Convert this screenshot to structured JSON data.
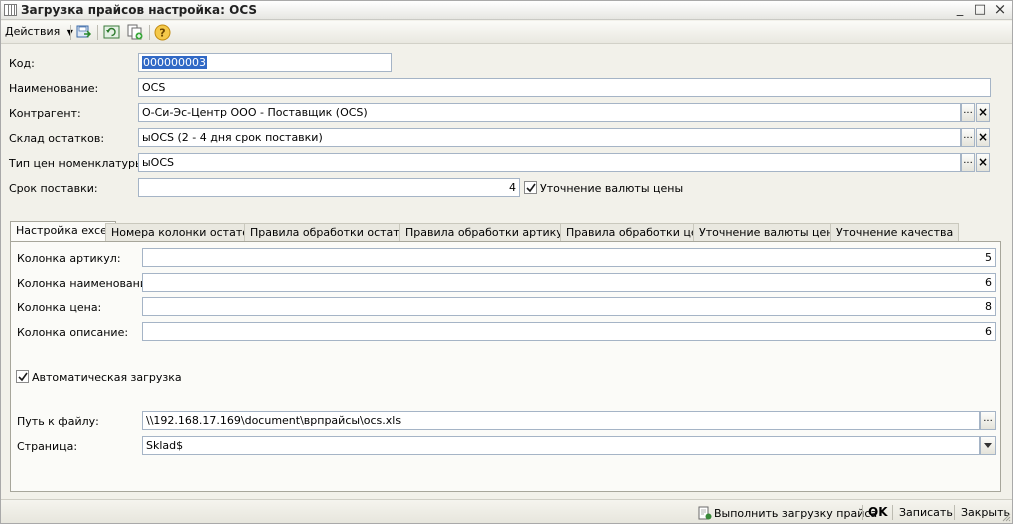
{
  "window": {
    "title": "Загрузка прайсов настройка: OCS",
    "controls": {
      "minimize": "_",
      "maximize": "□",
      "close": "×"
    }
  },
  "toolbar": {
    "actions_label": "Действия",
    "icons": [
      "save-and-close-icon",
      "refresh-icon",
      "copy-icon",
      "help-icon"
    ]
  },
  "form": {
    "code": {
      "label": "Код:",
      "value": "000000003"
    },
    "name": {
      "label": "Наименование:",
      "value": "OCS"
    },
    "counterparty": {
      "label": "Контрагент:",
      "value": "О-Си-Эс-Центр ООО - Поставщик (OCS)"
    },
    "warehouse": {
      "label": "Склад остатков:",
      "value": "ыOCS (2 - 4 дня срок поставки)"
    },
    "price_type": {
      "label": "Тип цен номенклатуры:",
      "value": "ыOCS"
    },
    "delivery_term": {
      "label": "Срок поставки:",
      "value": "4"
    },
    "currency_check": {
      "label": "Уточнение валюты цены",
      "checked": true
    },
    "select_button": "...",
    "clear_button": "×"
  },
  "tabs": [
    {
      "label": "Настройка excel",
      "active": true
    },
    {
      "label": "Номера колонки остаток"
    },
    {
      "label": "Правила обработки остатка"
    },
    {
      "label": "Правила обработки артикула"
    },
    {
      "label": "Правила обработки цен"
    },
    {
      "label": "Уточнение валюты цены"
    },
    {
      "label": "Уточнение качества"
    }
  ],
  "excel": {
    "col_article": {
      "label": "Колонка артикул:",
      "value": "5"
    },
    "col_name": {
      "label": "Колонка наименование:",
      "value": "6"
    },
    "col_price": {
      "label": "Колонка цена:",
      "value": "8"
    },
    "col_desc": {
      "label": "Колонка описание:",
      "value": "6"
    },
    "auto_load": {
      "label": "Автоматическая загрузка",
      "checked": true
    },
    "file_path": {
      "label": "Путь к файлу:",
      "value": "\\\\192.168.17.169\\document\\врпрайсы\\ocs.xls"
    },
    "sheet": {
      "label": "Страница:",
      "value": "Sklad$"
    }
  },
  "bottom": {
    "run_load": "Выполнить загрузку прайса",
    "ok": "OK",
    "save": "Записать",
    "close": "Закрыть"
  },
  "colors": {
    "selection": "#3169c6",
    "field_border": "#a5b4c6",
    "background": "#f2f1ea"
  }
}
